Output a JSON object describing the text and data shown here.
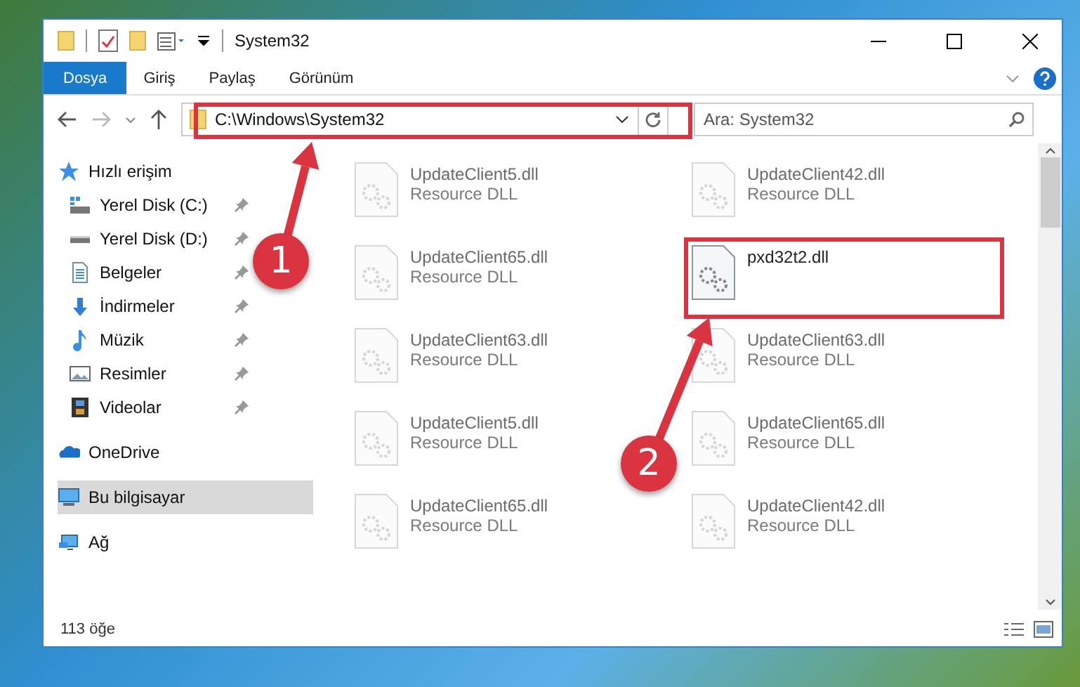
{
  "window": {
    "title": "System32"
  },
  "ribbon_tabs": [
    {
      "label": "Dosya",
      "selected": true
    },
    {
      "label": "Giriş",
      "selected": false
    },
    {
      "label": "Paylaş",
      "selected": false
    },
    {
      "label": "Görünüm",
      "selected": false
    }
  ],
  "address_bar": {
    "path": "C:\\Windows\\System32"
  },
  "search": {
    "placeholder": "Ara: System32"
  },
  "sidebar": {
    "items": [
      {
        "label": "Hızlı erişim",
        "kind": "star",
        "selected": false,
        "children": [
          {
            "label": "Yerel Disk (C:)",
            "kind": "drive-c",
            "pinned": true,
            "selected": false
          },
          {
            "label": "Yerel Disk (D:)",
            "kind": "drive",
            "pinned": true,
            "selected": false
          },
          {
            "label": "Belgeler",
            "kind": "document",
            "pinned": true,
            "selected": false
          },
          {
            "label": "İndirmeler",
            "kind": "download",
            "pinned": true,
            "selected": false
          },
          {
            "label": "Müzik",
            "kind": "music",
            "pinned": true,
            "selected": false
          },
          {
            "label": "Resimler",
            "kind": "pictures",
            "pinned": true,
            "selected": false
          },
          {
            "label": "Videolar",
            "kind": "video",
            "pinned": true,
            "selected": false
          }
        ]
      },
      {
        "label": "OneDrive",
        "kind": "cloud",
        "selected": false
      },
      {
        "label": "Bu bilgisayar",
        "kind": "computer",
        "selected": true
      },
      {
        "label": "Ağ",
        "kind": "network",
        "selected": false
      }
    ]
  },
  "files": [
    {
      "name": "UpdateClient5.dll",
      "type": "Resource DLL",
      "blurred": true,
      "highlighted": false
    },
    {
      "name": "UpdateClient42.dll",
      "type": "Resource DLL",
      "blurred": true,
      "highlighted": false
    },
    {
      "name": "UpdateClient65.dll",
      "type": "Resource DLL",
      "blurred": true,
      "highlighted": false
    },
    {
      "name": "pxd32t2.dll",
      "blurred": false,
      "highlighted": true
    },
    {
      "name": "UpdateClient63.dll",
      "type": "Resource DLL",
      "blurred": true,
      "highlighted": false
    },
    {
      "name": "UpdateClient63.dll",
      "type": "Resource DLL",
      "blurred": true,
      "highlighted": false
    },
    {
      "name": "UpdateClient5.dll",
      "type": "Resource DLL",
      "blurred": true,
      "highlighted": false
    },
    {
      "name": "UpdateClient65.dll",
      "type": "Resource DLL",
      "blurred": true,
      "highlighted": false
    },
    {
      "name": "UpdateClient65.dll",
      "type": "Resource DLL",
      "blurred": true,
      "highlighted": false
    },
    {
      "name": "UpdateClient42.dll",
      "type": "Resource DLL",
      "blurred": true,
      "highlighted": false
    }
  ],
  "status_bar": {
    "item_count": "113 öğe"
  },
  "annotations": [
    {
      "number": "1"
    },
    {
      "number": "2"
    }
  ]
}
